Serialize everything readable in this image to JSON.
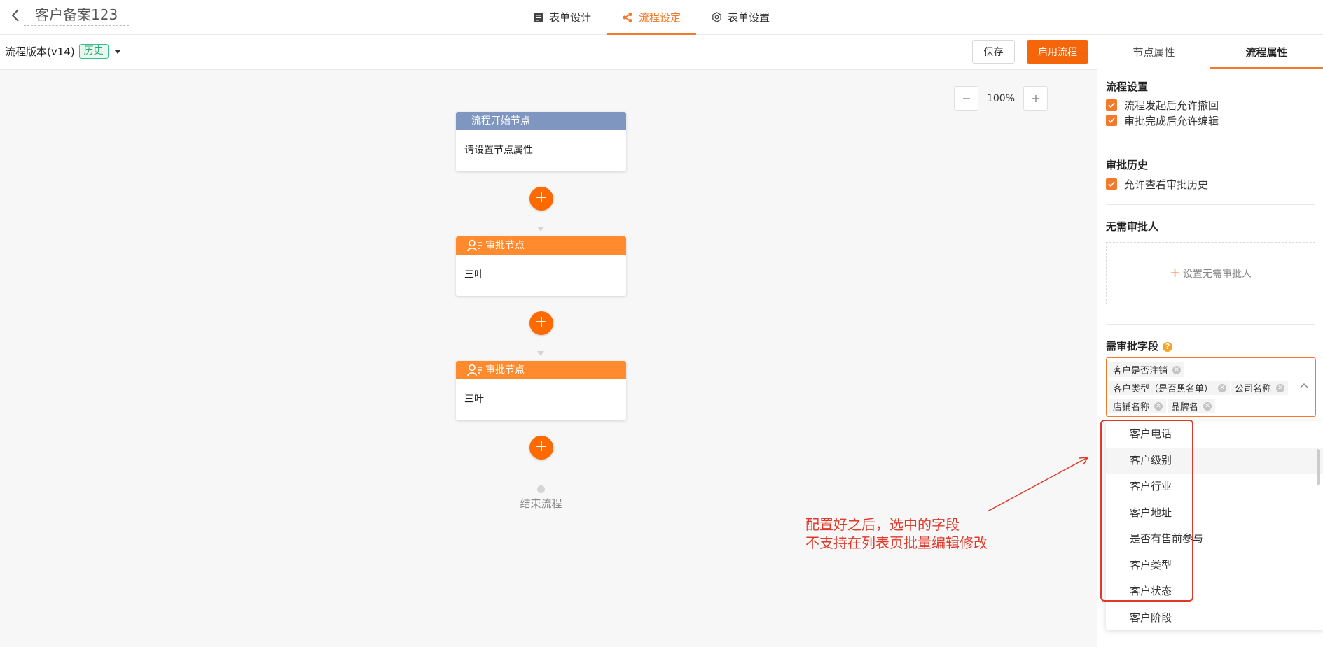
{
  "header": {
    "title": "客户备案123",
    "tabs": [
      {
        "label": "表单设计",
        "icon": "form-icon"
      },
      {
        "label": "流程设定",
        "icon": "flow-icon"
      },
      {
        "label": "表单设置",
        "icon": "gear-icon"
      }
    ]
  },
  "toolbar": {
    "version": "流程版本(v14)",
    "history_badge": "历史",
    "save_label": "保存",
    "enable_label": "启用流程"
  },
  "canvas": {
    "zoom": "100%",
    "start_node": {
      "title": "流程开始节点",
      "body": "请设置节点属性"
    },
    "approval_nodes": [
      {
        "title": "审批节点",
        "body": "三叶"
      },
      {
        "title": "审批节点",
        "body": "三叶"
      }
    ],
    "end_label": "结束流程"
  },
  "annotation": {
    "line1": "配置好之后，选中的字段",
    "line2": "不支持在列表页批量编辑修改",
    "color": "#e0392a"
  },
  "panel": {
    "tabs": [
      "节点属性",
      "流程属性"
    ],
    "flow_settings": {
      "title": "流程设置",
      "options": [
        "流程发起后允许撤回",
        "审批完成后允许编辑"
      ]
    },
    "history": {
      "title": "审批历史",
      "options": [
        "允许查看审批历史"
      ]
    },
    "no_approver": {
      "title": "无需审批人",
      "button": "设置无需审批人"
    },
    "fields": {
      "title": "需审批字段",
      "selected": [
        "客户是否注销",
        "客户类型（是否黑名单）",
        "公司名称",
        "店铺名称",
        "品牌名"
      ],
      "options": [
        "客户电话",
        "客户级别",
        "客户行业",
        "客户地址",
        "是否有售前参与",
        "客户类型",
        "客户状态",
        "客户阶段"
      ]
    }
  },
  "colors": {
    "accent": "#f5792a",
    "primary_button": "#f5650a",
    "start_node": "#7f97c0",
    "approval_node": "#ff8b2e"
  }
}
